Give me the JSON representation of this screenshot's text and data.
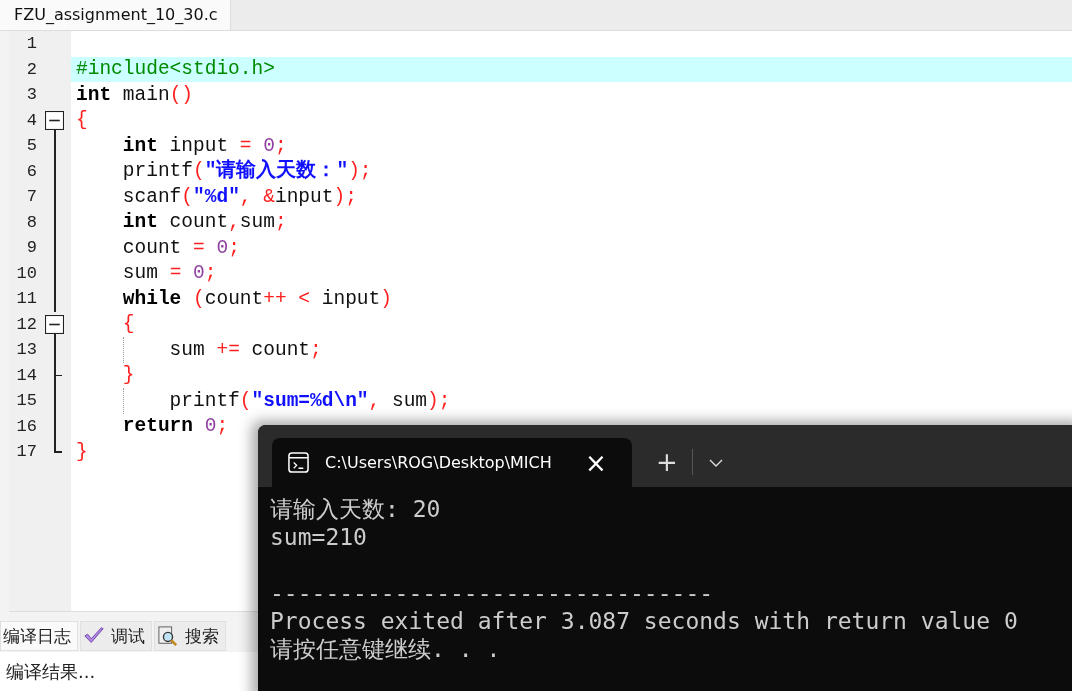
{
  "editor": {
    "tabs": [
      {
        "label": "FZU_assignment_10_30.c",
        "selected": true
      }
    ],
    "lines": [
      {
        "number": "1",
        "kind": "plain",
        "highlighted": false,
        "guide": false
      },
      {
        "number": "2",
        "kind": "plain",
        "highlighted": true,
        "guide": false,
        "tokens": [
          {
            "text": "#include<stdio.h>",
            "kind": "preproc"
          }
        ]
      },
      {
        "number": "3",
        "kind": "plain",
        "highlighted": false,
        "guide": false,
        "tokens": [
          {
            "text": "int",
            "kind": "keyword"
          },
          {
            "text": " main",
            "kind": "ident"
          },
          {
            "text": "()",
            "kind": "punct"
          }
        ]
      },
      {
        "number": "4",
        "kind": "fold-start",
        "highlighted": false,
        "guide": false,
        "tokens": [
          {
            "text": "{",
            "kind": "punct"
          }
        ]
      },
      {
        "number": "5",
        "kind": "fold-body",
        "highlighted": false,
        "guide": false,
        "tokens": [
          {
            "text": "    int",
            "kind": "keyword"
          },
          {
            "text": " input ",
            "kind": "ident"
          },
          {
            "text": "=",
            "kind": "punct"
          },
          {
            "text": " 0",
            "kind": "number"
          },
          {
            "text": ";",
            "kind": "punct"
          }
        ]
      },
      {
        "number": "6",
        "kind": "fold-body",
        "highlighted": false,
        "guide": false,
        "tokens": [
          {
            "text": "    printf",
            "kind": "ident"
          },
          {
            "text": "(",
            "kind": "punct"
          },
          {
            "text": "\"请输入天数：\"",
            "kind": "string"
          },
          {
            "text": ");",
            "kind": "punct"
          }
        ]
      },
      {
        "number": "7",
        "kind": "fold-body",
        "highlighted": false,
        "guide": false,
        "tokens": [
          {
            "text": "    scanf",
            "kind": "ident"
          },
          {
            "text": "(",
            "kind": "punct"
          },
          {
            "text": "\"%d\"",
            "kind": "string"
          },
          {
            "text": ", &",
            "kind": "punct"
          },
          {
            "text": "input",
            "kind": "ident"
          },
          {
            "text": ");",
            "kind": "punct"
          }
        ]
      },
      {
        "number": "8",
        "kind": "fold-body",
        "highlighted": false,
        "guide": false,
        "tokens": [
          {
            "text": "    int",
            "kind": "keyword"
          },
          {
            "text": " count",
            "kind": "ident"
          },
          {
            "text": ",",
            "kind": "punct"
          },
          {
            "text": "sum",
            "kind": "ident"
          },
          {
            "text": ";",
            "kind": "punct"
          }
        ]
      },
      {
        "number": "9",
        "kind": "fold-body",
        "highlighted": false,
        "guide": false,
        "tokens": [
          {
            "text": "    count ",
            "kind": "ident"
          },
          {
            "text": "=",
            "kind": "punct"
          },
          {
            "text": " 0",
            "kind": "number"
          },
          {
            "text": ";",
            "kind": "punct"
          }
        ]
      },
      {
        "number": "10",
        "kind": "fold-body",
        "highlighted": false,
        "guide": false,
        "tokens": [
          {
            "text": "    sum ",
            "kind": "ident"
          },
          {
            "text": "=",
            "kind": "punct"
          },
          {
            "text": " 0",
            "kind": "number"
          },
          {
            "text": ";",
            "kind": "punct"
          }
        ]
      },
      {
        "number": "11",
        "kind": "fold-body",
        "highlighted": false,
        "guide": false,
        "tokens": [
          {
            "text": "    while",
            "kind": "keyword"
          },
          {
            "text": " (",
            "kind": "punct"
          },
          {
            "text": "count",
            "kind": "ident"
          },
          {
            "text": "++ < ",
            "kind": "punct"
          },
          {
            "text": "input",
            "kind": "ident"
          },
          {
            "text": ")",
            "kind": "punct"
          }
        ]
      },
      {
        "number": "12",
        "kind": "fold-start",
        "highlighted": false,
        "guide": false,
        "tokens": [
          {
            "text": "    {",
            "kind": "punct"
          }
        ]
      },
      {
        "number": "13",
        "kind": "fold-body",
        "highlighted": false,
        "guide": true,
        "tokens": [
          {
            "text": "        sum ",
            "kind": "ident"
          },
          {
            "text": "+=",
            "kind": "punct"
          },
          {
            "text": " count",
            "kind": "ident"
          },
          {
            "text": ";",
            "kind": "punct"
          }
        ]
      },
      {
        "number": "14",
        "kind": "fold-end",
        "highlighted": false,
        "guide": false,
        "tokens": [
          {
            "text": "    }",
            "kind": "punct"
          }
        ]
      },
      {
        "number": "15",
        "kind": "fold-body",
        "highlighted": false,
        "guide": true,
        "tokens": [
          {
            "text": "        printf",
            "kind": "ident"
          },
          {
            "text": "(",
            "kind": "punct"
          },
          {
            "text": "\"sum=%d\\n\"",
            "kind": "string"
          },
          {
            "text": ", ",
            "kind": "punct"
          },
          {
            "text": "sum",
            "kind": "ident"
          },
          {
            "text": ");",
            "kind": "punct"
          }
        ]
      },
      {
        "number": "16",
        "kind": "fold-body",
        "highlighted": false,
        "guide": false,
        "tokens": [
          {
            "text": "    return",
            "kind": "keyword"
          },
          {
            "text": " 0",
            "kind": "number"
          },
          {
            "text": ";",
            "kind": "punct"
          }
        ]
      },
      {
        "number": "17",
        "kind": "fold-last",
        "highlighted": false,
        "guide": false,
        "tokens": [
          {
            "text": "}",
            "kind": "punct"
          }
        ]
      }
    ]
  },
  "bottom_panel": {
    "tabs": [
      {
        "label": "编译日志",
        "kind": "text",
        "selected": true
      },
      {
        "label": "调试",
        "kind": "check",
        "selected": false
      },
      {
        "label": "搜索",
        "kind": "search",
        "selected": false
      }
    ],
    "log": "编译结果..."
  },
  "terminal": {
    "tab_title": "C:\\Users\\ROG\\Desktop\\MICH",
    "close": "×",
    "new_tab": "+",
    "output": [
      {
        "kind": "text",
        "text": "请输入天数: 20"
      },
      {
        "kind": "text",
        "text": "sum=210"
      },
      {
        "kind": "blank"
      },
      {
        "kind": "text",
        "text": "--------------------------------"
      },
      {
        "kind": "text",
        "text": "Process exited after 3.087 seconds with return value 0"
      },
      {
        "kind": "text",
        "text": "请按任意键继续. . ."
      }
    ]
  }
}
